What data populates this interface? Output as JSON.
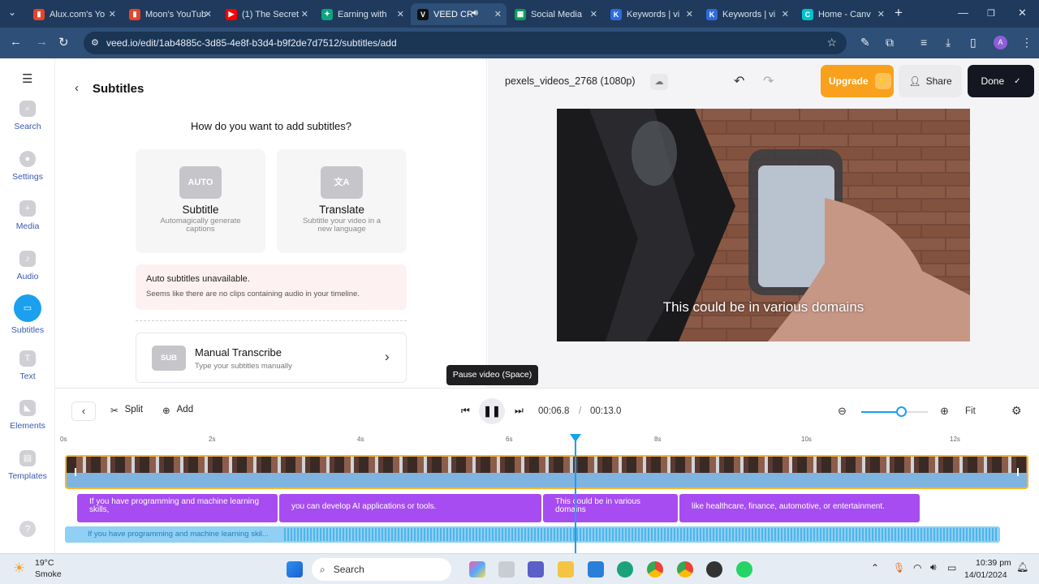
{
  "browser": {
    "tabs": [
      {
        "label": "Alux.com's Yo",
        "icon": "bars-chart-favicon",
        "color": "#e8442a"
      },
      {
        "label": "Moon's YouTub",
        "icon": "bars-chart-favicon",
        "color": "#e8442a"
      },
      {
        "label": "(1) The Secret",
        "icon": "youtube-favicon",
        "color": "#ff0000"
      },
      {
        "label": "Earning with",
        "icon": "chatgpt-favicon",
        "color": "#10a37f"
      },
      {
        "label": "VEED CR",
        "icon": "veed-favicon",
        "color": "#111111"
      },
      {
        "label": "Social Media",
        "icon": "sheets-favicon",
        "color": "#0f9d58"
      },
      {
        "label": "Keywords | vi",
        "icon": "keywords-favicon",
        "color": "#2d6cdf"
      },
      {
        "label": "Keywords | vi",
        "icon": "keywords-favicon",
        "color": "#2d6cdf"
      },
      {
        "label": "Home - Canv",
        "icon": "canva-favicon",
        "color": "#00c4cc"
      }
    ],
    "url": "veed.io/edit/1ab4885c-3d85-4e8f-b3d4-b9f2de7d7512/subtitles/add",
    "profile_initial": "A"
  },
  "rail": {
    "items": [
      {
        "label": "Search",
        "icon": "search-icon"
      },
      {
        "label": "Settings",
        "icon": "settings-icon"
      },
      {
        "label": "Media",
        "icon": "plus-icon"
      },
      {
        "label": "Audio",
        "icon": "music-note-icon"
      },
      {
        "label": "Subtitles",
        "icon": "subtitles-icon"
      },
      {
        "label": "Text",
        "icon": "text-icon"
      },
      {
        "label": "Elements",
        "icon": "elements-icon"
      },
      {
        "label": "Templates",
        "icon": "templates-icon"
      }
    ]
  },
  "panel": {
    "title": "Subtitles",
    "question": "How do you want to add subtitles?",
    "cards": [
      {
        "badge": "AUTO",
        "title": "Subtitle",
        "desc": "Automagically generate captions"
      },
      {
        "badge": "文A",
        "title": "Translate",
        "desc": "Subtitle your video in a new language"
      }
    ],
    "alert_title": "Auto subtitles unavailable.",
    "alert_body": "Seems like there are no clips containing audio in your timeline.",
    "manual_badge": "SUB",
    "manual_title": "Manual Transcribe",
    "manual_desc": "Type your subtitles manually"
  },
  "header": {
    "file_name": "pexels_videos_2768 (1080p)",
    "upgrade_label": "Upgrade",
    "share_label": "Share",
    "done_label": "Done"
  },
  "video": {
    "caption": "This could be in various domains"
  },
  "playback": {
    "tooltip": "Pause video (Space)",
    "current_time": "00:06.8",
    "separator": "/",
    "total_time": "00:13.0",
    "split_label": "Split",
    "add_label": "Add",
    "fit_label": "Fit",
    "zoom_level": 0.6
  },
  "ruler": {
    "ticks": [
      "0s",
      "2s",
      "4s",
      "6s",
      "8s",
      "10s",
      "12s"
    ]
  },
  "subtitle_track": {
    "segments": [
      "If you have programming and machine learning skills,",
      "you can develop AI applications or tools.",
      "This could be in various domains",
      "like healthcare, finance, automotive, or entertainment."
    ]
  },
  "audio_track": {
    "label": "If you have programming and machine learning skil..."
  },
  "taskbar": {
    "weather_temp": "19°C",
    "weather_desc": "Smoke",
    "search_label": "Search",
    "time": "10:39 pm",
    "date": "14/01/2024"
  }
}
